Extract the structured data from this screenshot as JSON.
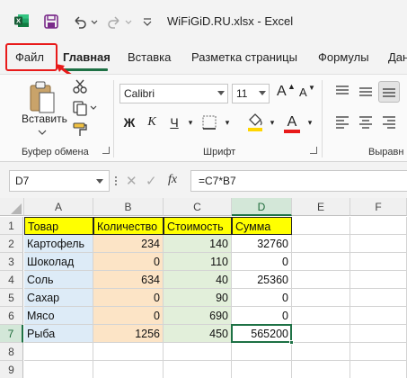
{
  "titlebar": {
    "title": "WiFiGiD.RU.xlsx  -  Excel"
  },
  "tabs": [
    "Файл",
    "Главная",
    "Вставка",
    "Разметка страницы",
    "Формулы",
    "Дан"
  ],
  "ribbon": {
    "paste_label": "Вставить",
    "clipboard_label": "Буфер обмена",
    "font_label": "Шрифт",
    "align_label": "Выравн",
    "font_name": "Calibri",
    "font_size": "11",
    "bold": "Ж",
    "italic": "К",
    "underline": "Ч",
    "grow_font": "A",
    "shrink_font": "A",
    "font_color": "A"
  },
  "formula_bar": {
    "name_box": "D7",
    "fx": "fx",
    "formula": "=C7*B7"
  },
  "grid": {
    "columns": [
      "A",
      "B",
      "C",
      "D",
      "E",
      "F"
    ],
    "rows": [
      "1",
      "2",
      "3",
      "4",
      "5",
      "6",
      "7",
      "8",
      "9"
    ],
    "header": [
      "Товар",
      "Количество",
      "Стоимость",
      "Сумма"
    ],
    "data": [
      [
        "Картофель",
        "234",
        "140",
        "32760"
      ],
      [
        "Шоколад",
        "0",
        "110",
        "0"
      ],
      [
        "Соль",
        "634",
        "40",
        "25360"
      ],
      [
        "Сахар",
        "0",
        "90",
        "0"
      ],
      [
        "Мясо",
        "0",
        "690",
        "0"
      ],
      [
        "Рыба",
        "1256",
        "450",
        "565200"
      ]
    ],
    "colors": {
      "header": "#ffff00",
      "col_a": "#ddebf7",
      "col_b": "#fce4c6",
      "col_c": "#e2efda",
      "accent": "#1e7145",
      "highlight": "#e81a1a"
    }
  }
}
